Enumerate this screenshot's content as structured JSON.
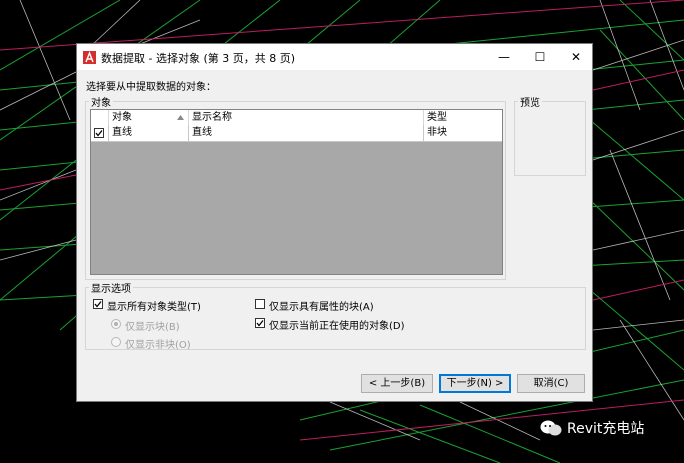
{
  "window": {
    "title": "数据提取 - 选择对象 (第 3 页，共 8 页)",
    "controls": [
      "—",
      "☐",
      "✕"
    ]
  },
  "instruction": "选择要从中提取数据的对象：",
  "objects_group": {
    "title": "对象",
    "columns": [
      "对象",
      "显示名称",
      "类型"
    ],
    "rows": [
      {
        "checked": true,
        "object": "直线",
        "display_name": "直线",
        "type": "非块"
      }
    ]
  },
  "preview_group": {
    "title": "预览"
  },
  "display_options": {
    "title": "显示选项",
    "show_all_types": {
      "label": "显示所有对象类型(T)",
      "checked": true
    },
    "blocks_only": {
      "label": "仅显示块(B)",
      "selected": true,
      "disabled": true
    },
    "non_blocks_only": {
      "label": "仅显示非块(O)",
      "selected": false,
      "disabled": true
    },
    "attr_blocks_only": {
      "label": "仅显示具有属性的块(A)",
      "checked": false
    },
    "in_use_only": {
      "label": "仅显示当前正在使用的对象(D)",
      "checked": true
    }
  },
  "buttons": {
    "back": "< 上一步(B)",
    "next": "下一步(N) >",
    "cancel": "取消(C)"
  },
  "watermark": "Revit充电站",
  "colors": {
    "accent": "#0078d7",
    "autocad_red": "#d32f2f"
  }
}
